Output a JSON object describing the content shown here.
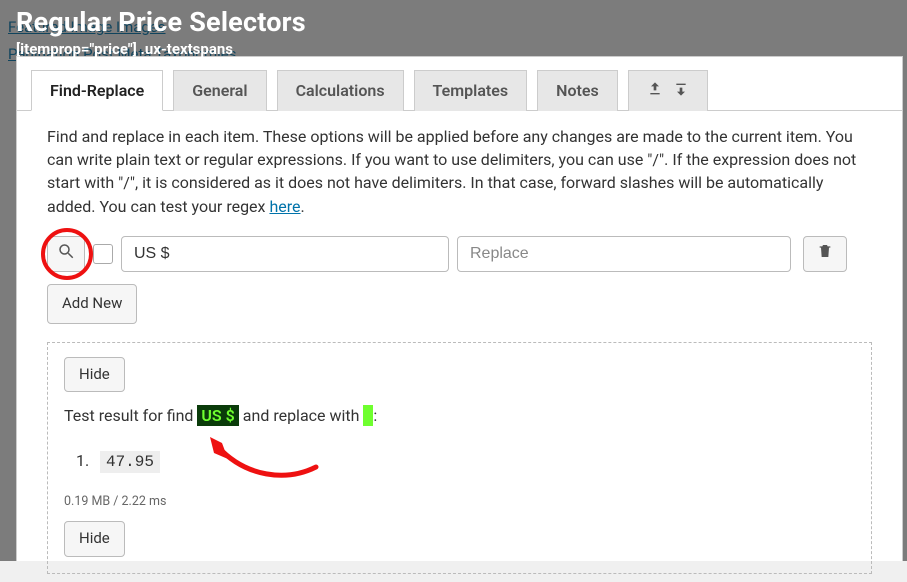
{
  "background_links_row1": "Featured Image  Images",
  "background_links_row2": "Pagination  Post Meta  Taxonomies",
  "header": {
    "title": "Regular Price Selectors",
    "subtitle": "[itemprop=\"price\"] .ux-textspans"
  },
  "tabs": {
    "find_replace": "Find-Replace",
    "general": "General",
    "calculations": "Calculations",
    "templates": "Templates",
    "notes": "Notes"
  },
  "description": {
    "text": "Find and replace in each item. These options will be applied before any changes are made to the current item. You can write plain text or regular expressions. If you want to use delimiters, you can use \"/\". If the expression does not start with \"/\", it is considered as it does not have delimiters. In that case, forward slashes will be automatically added. You can test your regex ",
    "link_text": "here",
    "period": "."
  },
  "controls": {
    "find_value": "US $",
    "replace_placeholder": "Replace",
    "add_new": "Add New"
  },
  "result": {
    "hide": "Hide",
    "prefix": "Test result for find ",
    "find_hl": "US $",
    "mid": " and replace with ",
    "colon": ":",
    "item_index": "1.",
    "item_value": "47.95",
    "stats": "0.19 MB / 2.22 ms"
  }
}
